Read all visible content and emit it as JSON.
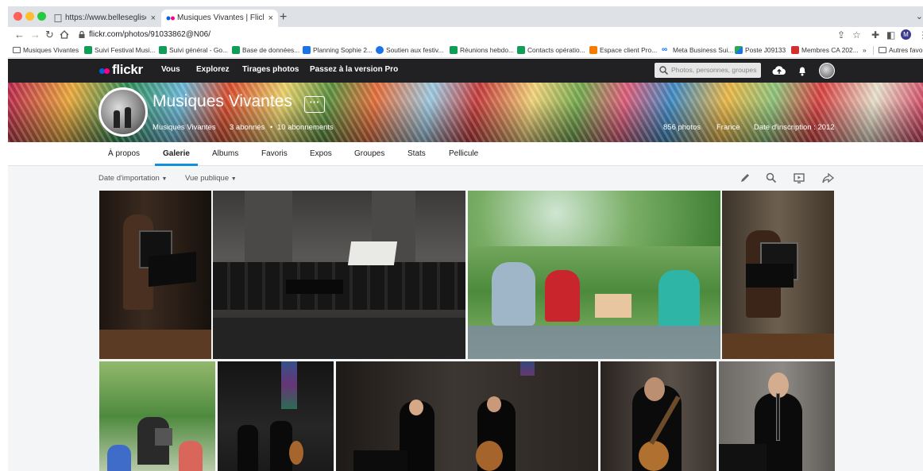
{
  "browser": {
    "tabs": [
      {
        "title": "https://www.belleseglises.com",
        "active": false
      },
      {
        "title": "Musiques Vivantes | Flickr",
        "active": true
      }
    ],
    "url": "flickr.com/photos/91033862@N06/",
    "bookmarks": [
      {
        "label": "Musiques Vivantes",
        "icon": "folder-icon",
        "color": "#5f6368"
      },
      {
        "label": "Suivi Festival Musi...",
        "icon": "sheets-icon",
        "color": "#0f9d58"
      },
      {
        "label": "Suivi général - Go...",
        "icon": "sheets-icon",
        "color": "#0f9d58"
      },
      {
        "label": "Base de données...",
        "icon": "sheets-icon",
        "color": "#0f9d58"
      },
      {
        "label": "Planning Sophie 2...",
        "icon": "calendar-icon",
        "color": "#1a73e8"
      },
      {
        "label": "Soutien aux festiv...",
        "icon": "globe-icon",
        "color": "#1a73e8"
      },
      {
        "label": "Réunions hebdo...",
        "icon": "sheets-icon",
        "color": "#0f9d58"
      },
      {
        "label": "Contacts opératio...",
        "icon": "sheets-icon",
        "color": "#0f9d58"
      },
      {
        "label": "Espace client Pro...",
        "icon": "square-icon",
        "color": "#f57c00"
      },
      {
        "label": "Meta Business Sui...",
        "icon": "meta-icon",
        "color": "#0866ff"
      },
      {
        "label": "Poste J09133",
        "icon": "arrow-icon",
        "color": "#2aa84a"
      },
      {
        "label": "Membres CA 202...",
        "icon": "pdf-icon",
        "color": "#d32f2f"
      },
      {
        "label": "Autres favoris",
        "icon": "folder-icon",
        "color": "#5f6368"
      }
    ],
    "bookmarks_overflow": "»"
  },
  "flickr": {
    "logo": "flickr",
    "nav": [
      "Vous",
      "Explorez",
      "Tirages photos",
      "Passez à la version Pro"
    ],
    "search_placeholder": "Photos, personnes, groupes",
    "profile": {
      "name": "Musiques Vivantes",
      "more": "···",
      "username": "Musiques Vivantes",
      "followers": "3 abonnés",
      "separator": "•",
      "following": "10 abonnements",
      "photos": "856 photos",
      "country": "France",
      "joined": "Date d'inscription : 2012"
    },
    "tabs": [
      "À propos",
      "Galerie",
      "Albums",
      "Favoris",
      "Expos",
      "Groupes",
      "Stats",
      "Pellicule"
    ],
    "active_tab": "Galerie",
    "filters": [
      "Date d'importation",
      "Vue publique"
    ],
    "accent": "#128fdc"
  }
}
